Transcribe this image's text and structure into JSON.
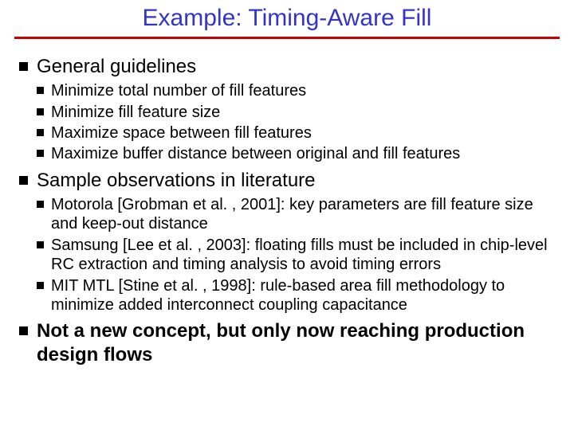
{
  "title": "Example: Timing-Aware Fill",
  "sections": [
    {
      "heading": "General guidelines",
      "items": [
        "Minimize total number of fill features",
        "Minimize fill feature size",
        "Maximize space between fill features",
        "Maximize buffer distance between original and fill features"
      ]
    },
    {
      "heading": "Sample observations in literature",
      "items": [
        "Motorola [Grobman et al. , 2001]: key parameters are fill feature size and keep-out distance",
        "Samsung [Lee et al. , 2003]: floating fills must be included in chip-level RC extraction and timing analysis to avoid timing errors",
        "MIT MTL [Stine et al. , 1998]: rule-based area fill methodology to minimize added interconnect coupling capacitance"
      ]
    },
    {
      "heading": "Not a new concept, but only now reaching production design flows",
      "bold": true,
      "items": []
    }
  ]
}
